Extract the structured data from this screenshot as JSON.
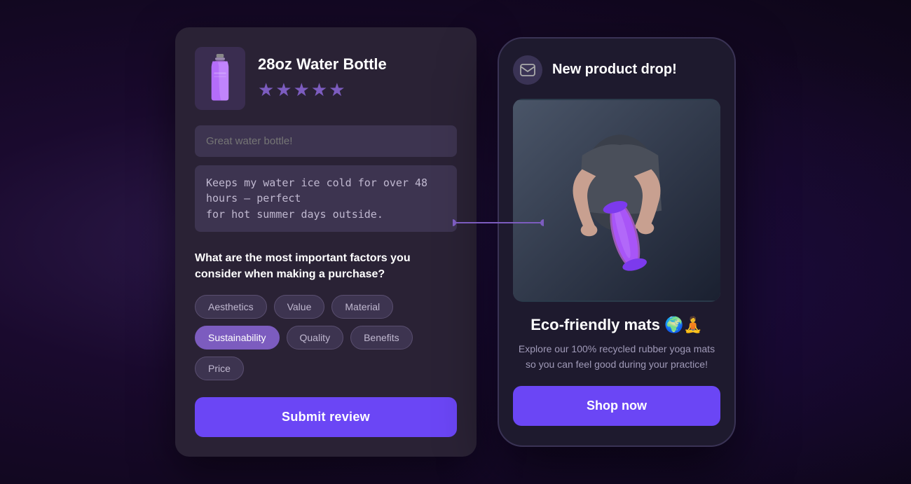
{
  "review_card": {
    "product_name": "28oz Water Bottle",
    "stars": "★★★★★",
    "review_title_placeholder": "Great water bottle!",
    "review_body": "Keeps my water ice cold for over 48 hours – perfect\nfor hot summer days outside.",
    "factors_question": "What are the most important factors you consider when making a purchase?",
    "factors": [
      {
        "label": "Aesthetics",
        "selected": false
      },
      {
        "label": "Value",
        "selected": false
      },
      {
        "label": "Material",
        "selected": false
      },
      {
        "label": "Sustainability",
        "selected": true
      },
      {
        "label": "Quality",
        "selected": false
      },
      {
        "label": "Benefits",
        "selected": false
      },
      {
        "label": "Price",
        "selected": false
      }
    ],
    "submit_label": "Submit review"
  },
  "phone": {
    "notification_title": "New product drop!",
    "mail_icon": "✉",
    "eco_title": "Eco-friendly mats 🌍🧘",
    "eco_desc": "Explore our 100% recycled rubber yoga mats so you can feel good during your practice!",
    "shop_label": "Shop now"
  },
  "colors": {
    "accent": "#6b46f5",
    "star": "#7c5cbf",
    "chip_selected_bg": "#7c5cbf",
    "connector": "#7c5cbf"
  }
}
